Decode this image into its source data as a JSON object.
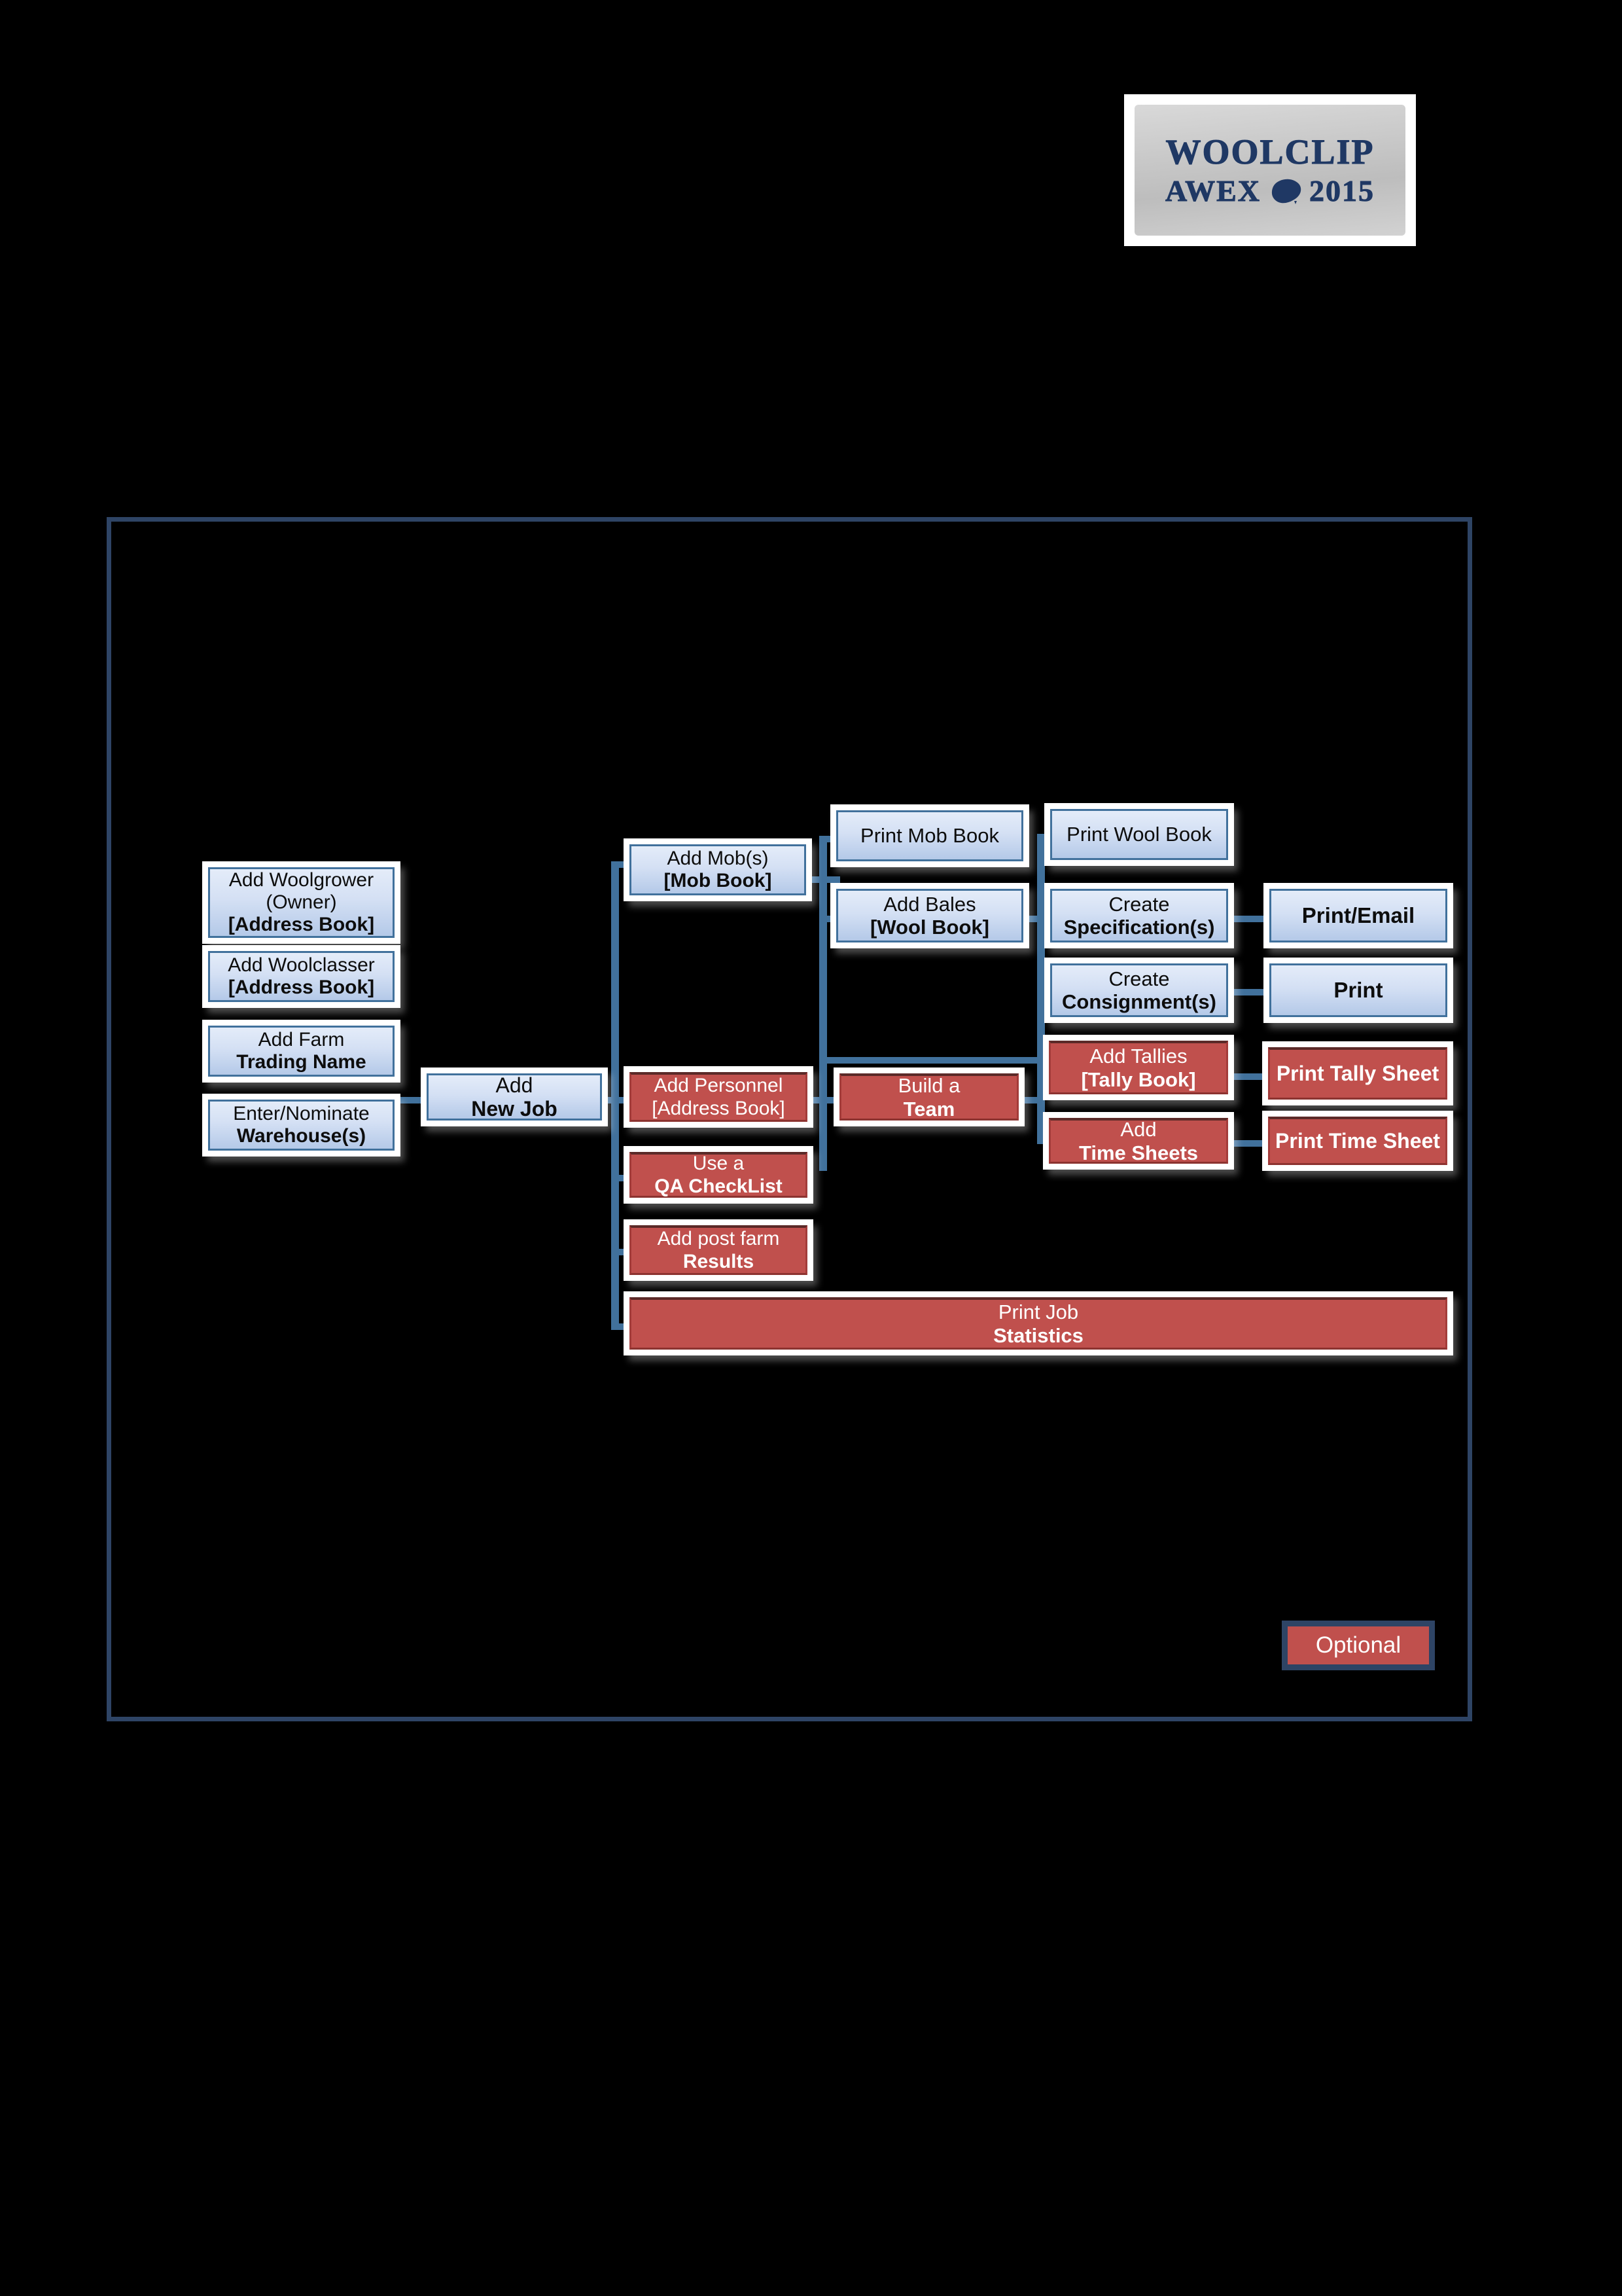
{
  "logo": {
    "line1": "WOOLCLIP",
    "line2_left": "AWEX",
    "line2_right": "2015",
    "map_icon": "australia-map-icon"
  },
  "banner": {
    "arrow_icon": "right-arrow-banner",
    "chip1_icon": "banner-chip-small",
    "chip2_icon": "banner-chip-wide",
    "white_panel_icon": "banner-white-panel"
  },
  "legend": {
    "optional_label": "Optional"
  },
  "colors": {
    "frame_border": "#2e4465",
    "connector": "#41719c",
    "blue_fill_top": "#e4ecf9",
    "blue_fill_bottom": "#b4c9e8",
    "blue_border": "#41719c",
    "red_fill": "#c0504d",
    "red_border": "#8c3330",
    "banner_blue": "#4f81bd",
    "banner_blue_dark": "#254061",
    "logo_navy": "#1f3864",
    "background": "#000000"
  },
  "nodes": {
    "add_woolgrower": {
      "line1": "Add Woolgrower",
      "line2": "(Owner)",
      "line3": "[Address Book]"
    },
    "add_woolclasser": {
      "line1": "Add Woolclasser",
      "line2": "[Address Book]"
    },
    "add_farm_trading_name": {
      "line1": "Add Farm ",
      "line2": "Trading Name"
    },
    "enter_nominate_warehouse": {
      "line1": "Enter/Nominate",
      "line2": "Warehouse(s)"
    },
    "add_new_job": {
      "line1": "Add ",
      "line2": "New Job"
    },
    "add_mobs": {
      "line1": "Add Mob(s)",
      "line2": "[Mob Book]"
    },
    "add_personnel": {
      "line1": "Add Personnel",
      "line2": "[Address Book]"
    },
    "use_qa_checklist": {
      "line1": "Use a ",
      "line2": "QA CheckList"
    },
    "add_post_farm_results": {
      "line1": "Add post farm",
      "line2": "Results"
    },
    "print_job_statistics": {
      "line1": "Print Job ",
      "line2": "Statistics"
    },
    "print_mob_book": {
      "line1": "Print Mob Book"
    },
    "add_bales": {
      "line1": "Add Bales",
      "line2": "[Wool Book]"
    },
    "print_wool_book": {
      "line1": "Print Wool Book"
    },
    "create_specifications": {
      "line1": "Create",
      "line2": "Specification(s)"
    },
    "create_consignments": {
      "line1": "Create",
      "line2": "Consignment(s)"
    },
    "print_email": {
      "line1": "Print/Email"
    },
    "print": {
      "line1": "Print"
    },
    "build_a_team": {
      "line1": "Build a ",
      "line2": "Team"
    },
    "add_tallies": {
      "line1": "Add Tallies ",
      "line2": "[Tally Book]"
    },
    "add_time_sheets": {
      "line1": "Add ",
      "line2": "Time Sheets"
    },
    "print_tally_sheet": {
      "line1": "Print Tally Sheet"
    },
    "print_time_sheet": {
      "line1": "Print Time Sheet"
    }
  }
}
